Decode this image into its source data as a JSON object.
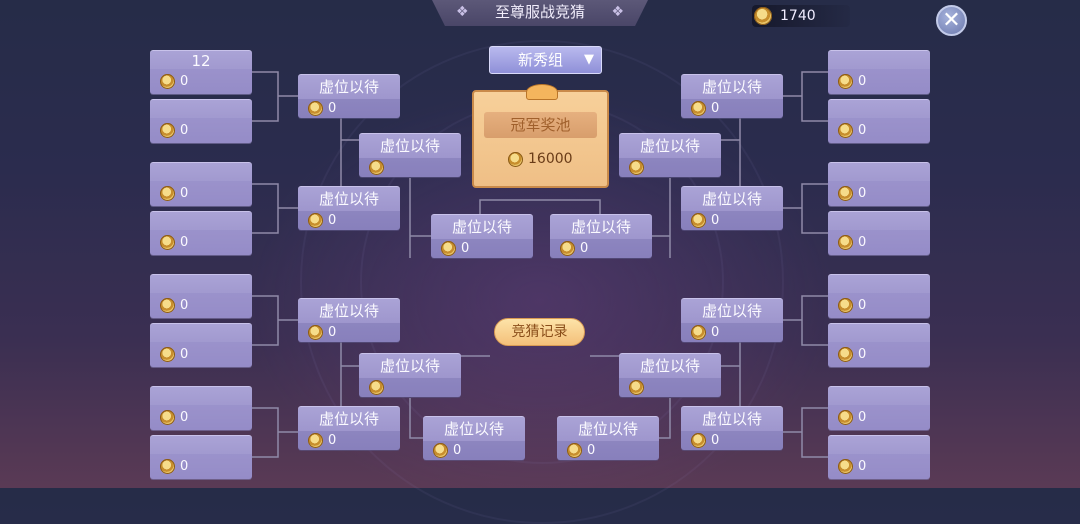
{
  "header": {
    "title": "至尊服战竞猜",
    "coins": "1740",
    "close_label": "✕"
  },
  "group_select": {
    "selected": "新秀组"
  },
  "prize_pool": {
    "title": "冠军奖池",
    "amount": "16000"
  },
  "record_button": "竞猜记录",
  "icons": {
    "coin": "coin-icon",
    "close": "close-icon",
    "dropdown": "triangle-down-icon"
  },
  "bracket": {
    "left_r1": [
      {
        "name": "12",
        "score": "0"
      },
      {
        "name": "",
        "score": "0"
      },
      {
        "name": "",
        "score": "0"
      },
      {
        "name": "",
        "score": "0"
      },
      {
        "name": "",
        "score": "0"
      },
      {
        "name": "",
        "score": "0"
      },
      {
        "name": "",
        "score": "0"
      },
      {
        "name": "",
        "score": "0"
      }
    ],
    "left_r2": [
      {
        "name": "虚位以待",
        "score": "0"
      },
      {
        "name": "虚位以待",
        "score": "0"
      },
      {
        "name": "虚位以待",
        "score": "0"
      },
      {
        "name": "虚位以待",
        "score": "0"
      }
    ],
    "left_r3": [
      {
        "name": "虚位以待",
        "score": ""
      },
      {
        "name": "虚位以待",
        "score": ""
      }
    ],
    "semi": [
      {
        "name": "虚位以待",
        "score": "0"
      },
      {
        "name": "虚位以待",
        "score": "0"
      }
    ],
    "bottom": [
      {
        "name": "虚位以待",
        "score": "0"
      },
      {
        "name": "虚位以待",
        "score": "0"
      }
    ],
    "right_r3": [
      {
        "name": "虚位以待",
        "score": ""
      },
      {
        "name": "虚位以待",
        "score": ""
      }
    ],
    "right_r2": [
      {
        "name": "虚位以待",
        "score": "0"
      },
      {
        "name": "虚位以待",
        "score": "0"
      },
      {
        "name": "虚位以待",
        "score": "0"
      },
      {
        "name": "虚位以待",
        "score": "0"
      }
    ],
    "right_r1": [
      {
        "name": "",
        "score": "0"
      },
      {
        "name": "",
        "score": "0"
      },
      {
        "name": "",
        "score": "0"
      },
      {
        "name": "",
        "score": "0"
      },
      {
        "name": "",
        "score": "0"
      },
      {
        "name": "",
        "score": "0"
      },
      {
        "name": "",
        "score": "0"
      },
      {
        "name": "",
        "score": "0"
      }
    ]
  }
}
